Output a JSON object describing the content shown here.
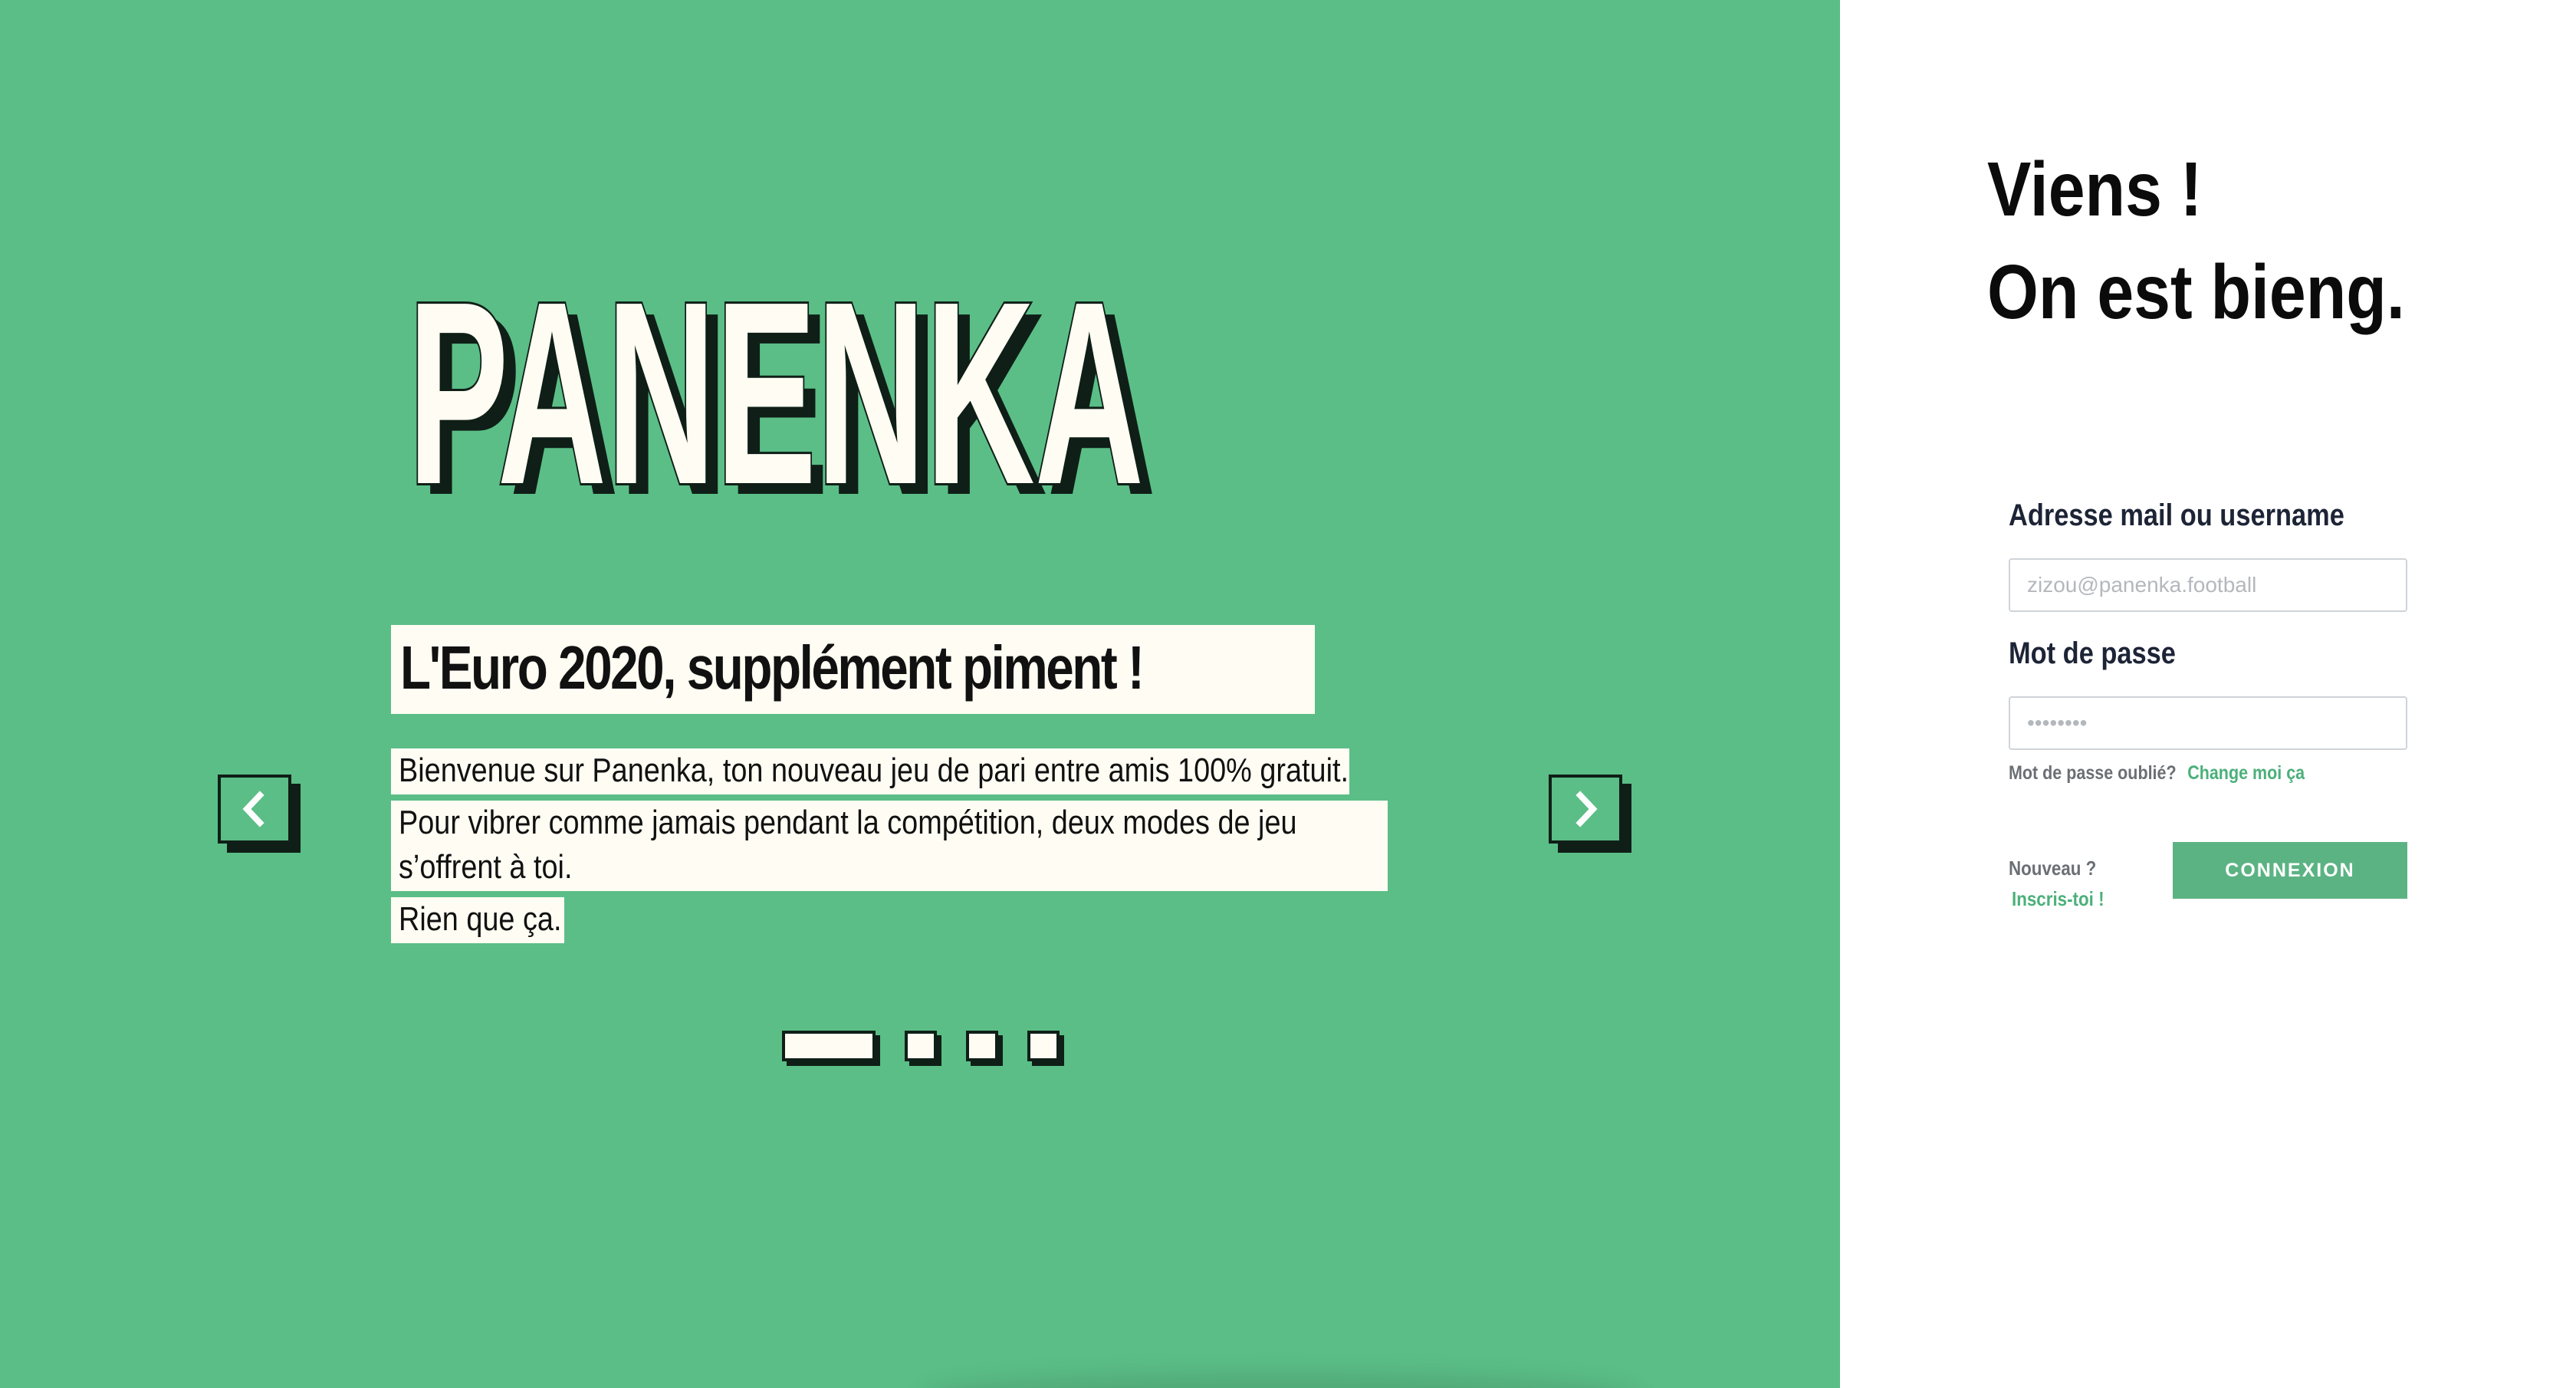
{
  "brand": {
    "logo_text": "PANENKA",
    "colors": {
      "primary_green": "#5bbe87",
      "button_green": "#5bb383",
      "link_green": "#4bb07a",
      "cream": "#fffdf3",
      "ink": "#0f1f17"
    }
  },
  "carousel": {
    "slide_title": "L'Euro 2020, supplément piment !",
    "slide_lines": [
      "Bienvenue sur Panenka, ton nouveau jeu de pari entre amis 100% gratuit.",
      "Pour vibrer comme jamais pendant la compétition, deux modes de jeu s’offrent à toi.",
      "Rien que ça."
    ],
    "prev_icon": "chevron-left-icon",
    "next_icon": "chevron-right-icon",
    "active_slide": 1,
    "slide_count": 4
  },
  "login": {
    "greeting_line_1": "Viens !",
    "greeting_line_2": "On est bieng.",
    "email_label": "Adresse mail ou username",
    "email_placeholder": "zizou@panenka.football",
    "email_value": "",
    "password_label": "Mot de passe",
    "password_placeholder": "••••••••",
    "password_value": "",
    "forgot_text": "Mot de passe oublié?",
    "forgot_link": "Change moi ça",
    "new_text": "Nouveau ?",
    "signup_link": "Inscris-toi !",
    "submit_label": "CONNEXION"
  }
}
